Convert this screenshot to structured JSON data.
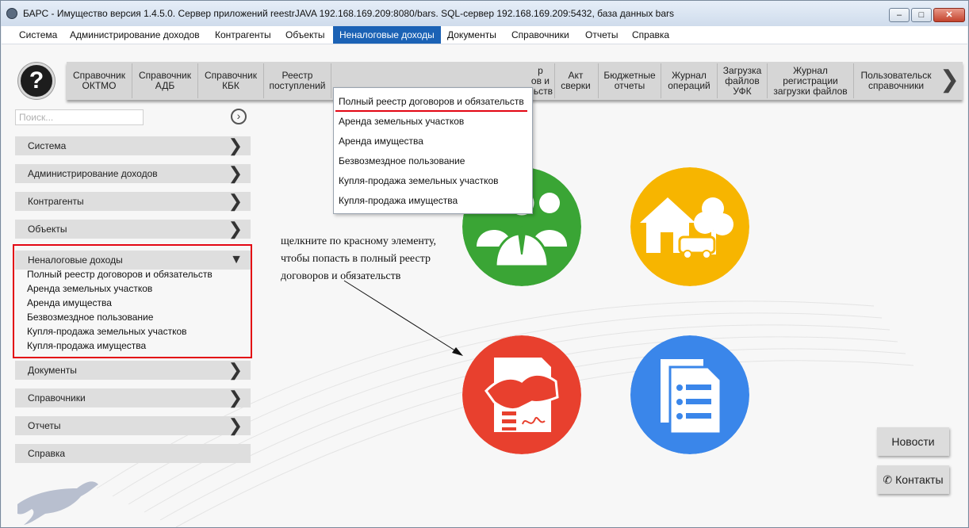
{
  "window": {
    "title": "БАРС - Имущество версия 1.4.5.0. Сервер приложений reestrJAVA 192.168.169.209:8080/bars. SQL-сервер 192.168.169.209:5432, база данных bars",
    "min_icon": "minimize-icon",
    "max_icon": "maximize-icon",
    "close_icon": "close-icon"
  },
  "menubar": [
    {
      "label": "Система"
    },
    {
      "label": "Администрирование доходов"
    },
    {
      "label": "Контрагенты"
    },
    {
      "label": "Объекты"
    },
    {
      "label": "Неналоговые доходы",
      "active": true
    },
    {
      "label": "Документы"
    },
    {
      "label": "Справочники"
    },
    {
      "label": "Отчеты"
    },
    {
      "label": "Справка"
    }
  ],
  "help_button": {
    "glyph": "?"
  },
  "toolbar": [
    {
      "label": "Справочник\nОКТМО"
    },
    {
      "label": "Справочник\nАДБ"
    },
    {
      "label": "Справочник\nКБК"
    },
    {
      "label": "Реестр\nпоступлений"
    },
    {
      "label": "р\nов и\nльств"
    },
    {
      "label": "Акт\nсверки"
    },
    {
      "label": "Бюджетные\nотчеты"
    },
    {
      "label": "Журнал\nопераций"
    },
    {
      "label": "Загрузка\nфайлов\nУФК"
    },
    {
      "label": "Журнал\nрегистрации\nзагрузки файлов"
    },
    {
      "label": "Пользовательск\nсправочники"
    }
  ],
  "search": {
    "placeholder": "Поиск..."
  },
  "sidebar": {
    "items_top": [
      {
        "label": "Система"
      },
      {
        "label": "Администрирование доходов"
      },
      {
        "label": "Контрагенты"
      },
      {
        "label": "Объекты"
      }
    ],
    "open_item": {
      "label": "Неналоговые доходы",
      "subitems": [
        "Полный реестр договоров и обязательств",
        "Аренда земельных участков",
        "Аренда имущества",
        "Безвозмездное пользование",
        "Купля-продажа земельных участков",
        "Купля-продажа имущества"
      ]
    },
    "items_bottom": [
      {
        "label": "Документы"
      },
      {
        "label": "Справочники"
      },
      {
        "label": "Отчеты"
      },
      {
        "label": "Справка"
      }
    ]
  },
  "dropdown": {
    "items": [
      "Полный реестр договоров и обязательств",
      "Аренда земельных участков",
      "Аренда имущества",
      "Безвозмездное пользование",
      "Купля-продажа земельных участков",
      "Купля-продажа имущества"
    ]
  },
  "hint": {
    "line1": "щелкните по красному элементу,",
    "line2": "чтобы попасть в полный реестр",
    "line3": "договоров и обязательств"
  },
  "tiles": [
    {
      "name": "contractors-tile",
      "color": "#3aa535",
      "icon": "people-icon"
    },
    {
      "name": "objects-tile",
      "color": "#f7b500",
      "icon": "house-car-tree-icon"
    },
    {
      "name": "nontax-income-tile",
      "color": "#e8402e",
      "icon": "handshake-contract-icon"
    },
    {
      "name": "documents-tile",
      "color": "#3a86ea",
      "icon": "documents-icon"
    }
  ],
  "side_buttons": {
    "news": "Новости",
    "contacts": "Контакты"
  },
  "colors": {
    "menu_active": "#1b62b5",
    "highlight_red": "#e30613"
  }
}
